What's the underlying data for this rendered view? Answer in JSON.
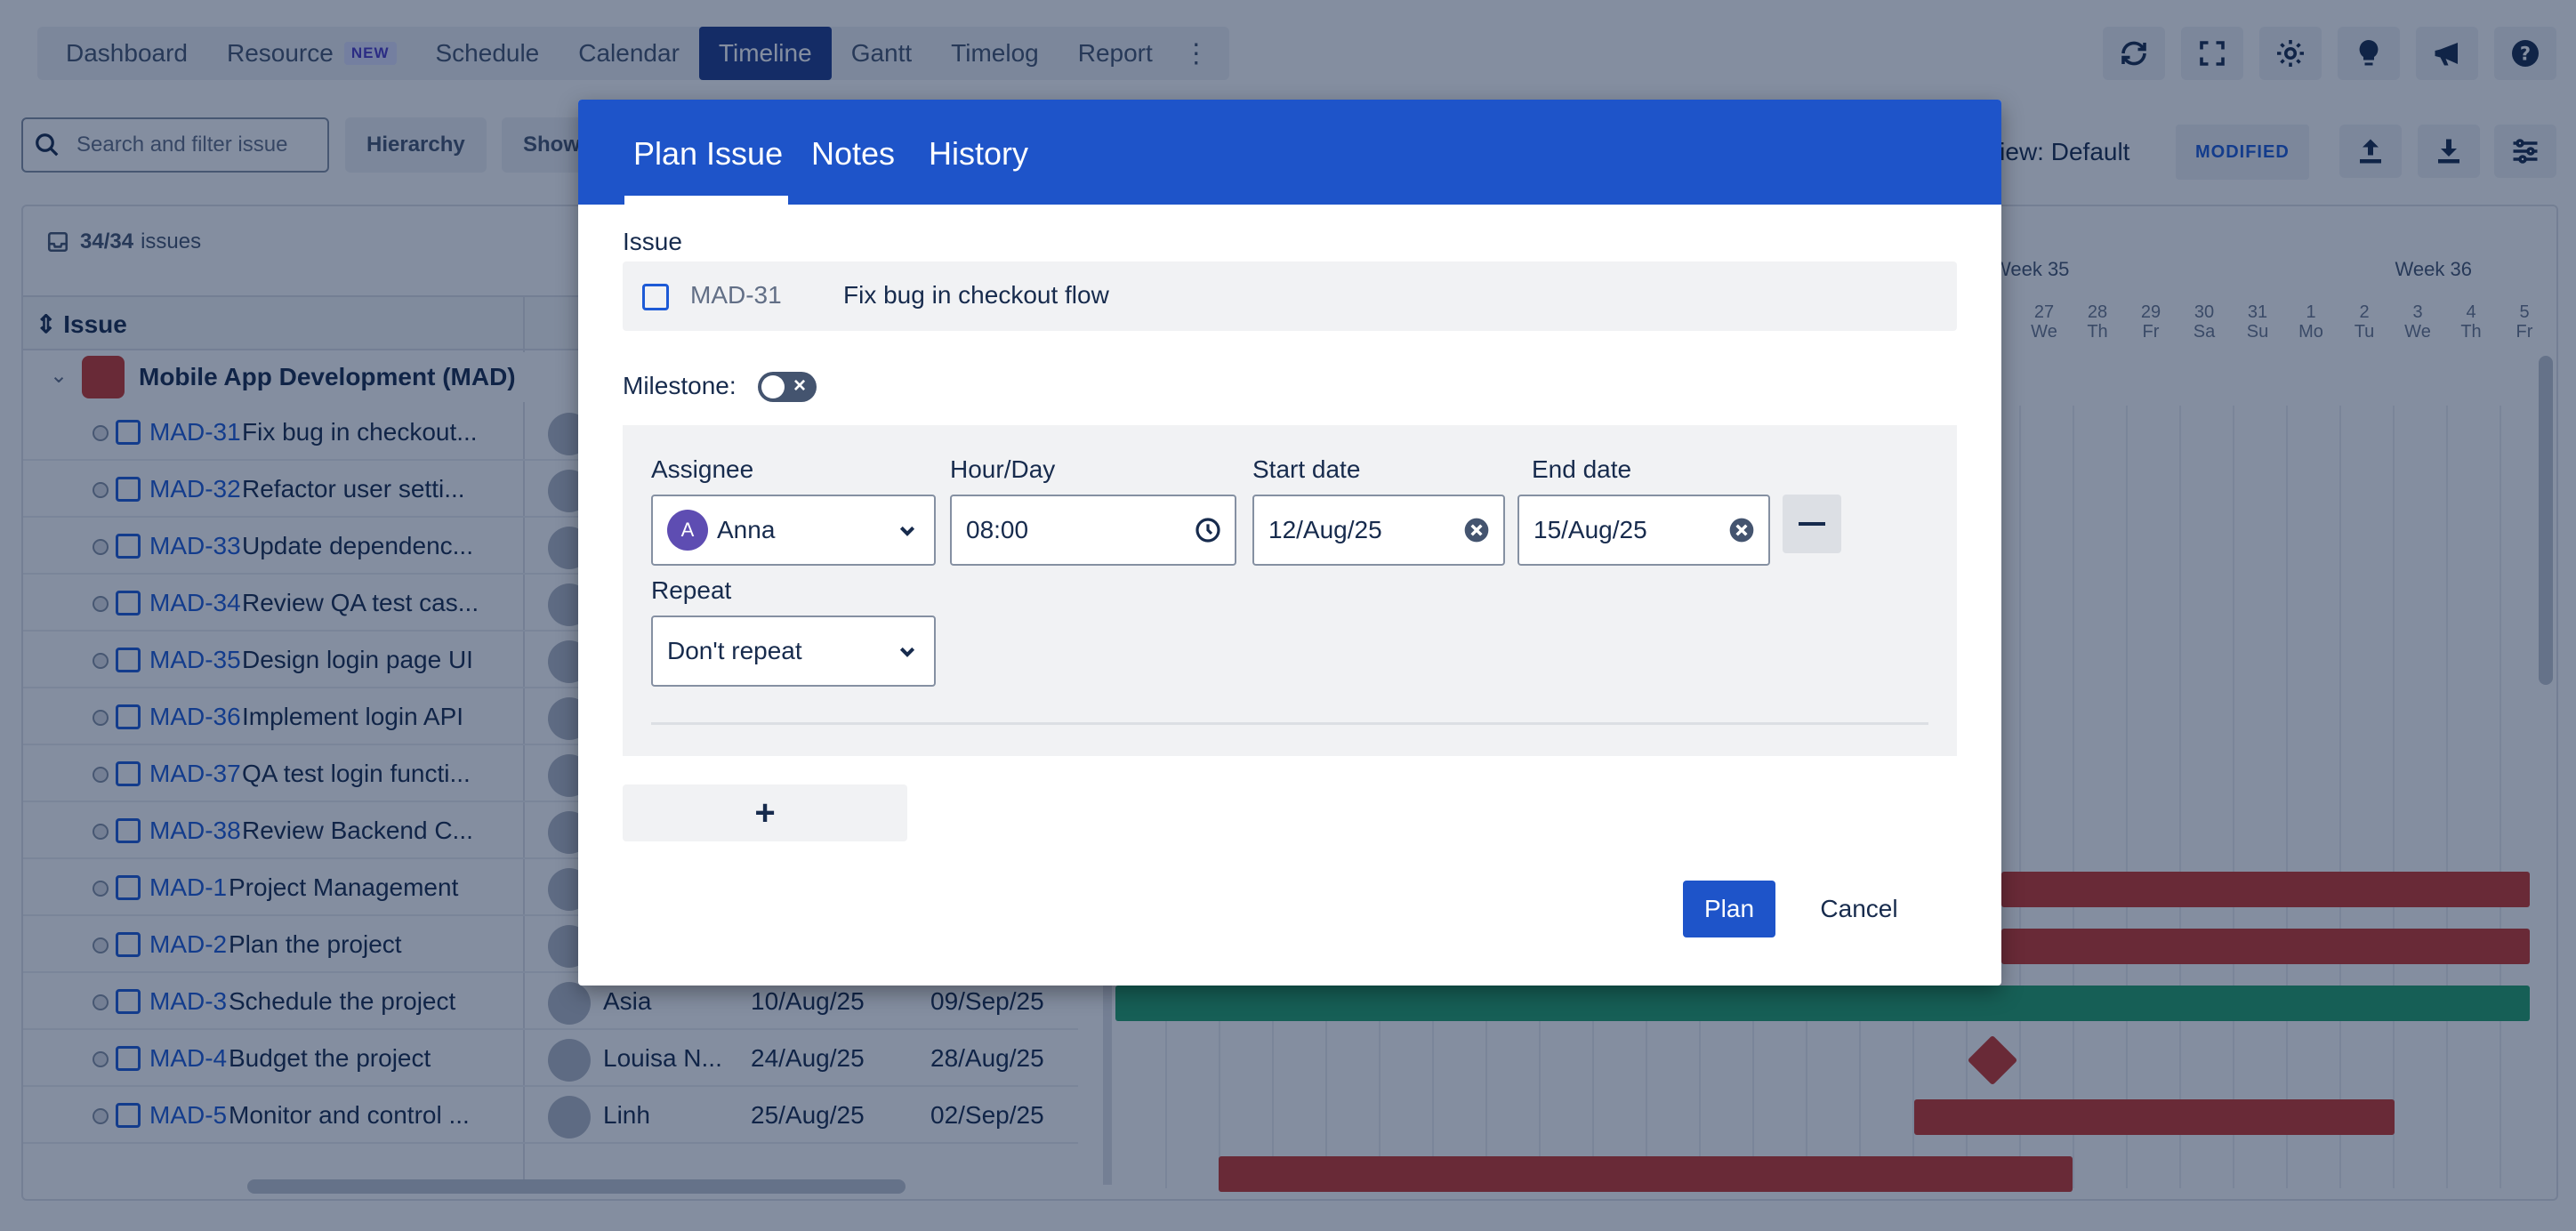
{
  "nav": {
    "tabs": [
      {
        "label": "Dashboard"
      },
      {
        "label": "Resource",
        "badge": "NEW"
      },
      {
        "label": "Schedule"
      },
      {
        "label": "Calendar"
      },
      {
        "label": "Timeline",
        "active": true
      },
      {
        "label": "Gantt"
      },
      {
        "label": "Timelog"
      },
      {
        "label": "Report"
      }
    ],
    "icons": [
      "refresh-icon",
      "fullscreen-icon",
      "settings-icon",
      "lightbulb-icon",
      "megaphone-icon",
      "help-icon"
    ]
  },
  "toolbar": {
    "search_placeholder": "Search and filter issue",
    "hierarchy_label": "Hierarchy",
    "show_label": "Show",
    "view_label": "View: Default",
    "modified_badge": "MODIFIED"
  },
  "grid": {
    "issues_count": "34/34",
    "issues_word": "issues",
    "issue_column": "Issue",
    "group": "Mobile App Development  (MAD)",
    "weeks": [
      "Week 35",
      "Week 36"
    ],
    "days": [
      {
        "d": "27",
        "w": "We"
      },
      {
        "d": "28",
        "w": "Th"
      },
      {
        "d": "29",
        "w": "Fr"
      },
      {
        "d": "30",
        "w": "Sa"
      },
      {
        "d": "31",
        "w": "Su"
      },
      {
        "d": "1",
        "w": "Mo"
      },
      {
        "d": "2",
        "w": "Tu"
      },
      {
        "d": "3",
        "w": "We"
      },
      {
        "d": "4",
        "w": "Th"
      },
      {
        "d": "5",
        "w": "Fr"
      }
    ],
    "rows": [
      {
        "key": "MAD-31",
        "title": "Fix bug in checkout...",
        "assignee": "",
        "start": "",
        "end": ""
      },
      {
        "key": "MAD-32",
        "title": "Refactor user setti...",
        "assignee": "",
        "start": "",
        "end": ""
      },
      {
        "key": "MAD-33",
        "title": "Update dependenc...",
        "assignee": "",
        "start": "",
        "end": ""
      },
      {
        "key": "MAD-34",
        "title": "Review QA test cas...",
        "assignee": "",
        "start": "",
        "end": ""
      },
      {
        "key": "MAD-35",
        "title": "Design login page UI",
        "assignee": "",
        "start": "",
        "end": ""
      },
      {
        "key": "MAD-36",
        "title": "Implement login API",
        "assignee": "",
        "start": "",
        "end": ""
      },
      {
        "key": "MAD-37",
        "title": "QA test login functi...",
        "assignee": "",
        "start": "",
        "end": ""
      },
      {
        "key": "MAD-38",
        "title": "Review Backend C...",
        "assignee": "",
        "start": "",
        "end": ""
      },
      {
        "key": "MAD-1",
        "title": "Project Management",
        "assignee": "",
        "start": "",
        "end": ""
      },
      {
        "key": "MAD-2",
        "title": "Plan the project",
        "assignee": "",
        "start": "",
        "end": ""
      },
      {
        "key": "MAD-3",
        "title": "Schedule the project",
        "assignee": "Asia",
        "start": "10/Aug/25",
        "end": "09/Sep/25"
      },
      {
        "key": "MAD-4",
        "title": "Budget the project",
        "assignee": "Louisa N...",
        "start": "24/Aug/25",
        "end": "28/Aug/25"
      },
      {
        "key": "MAD-5",
        "title": "Monitor and control ...",
        "assignee": "Linh",
        "start": "25/Aug/25",
        "end": "02/Sep/25"
      }
    ]
  },
  "modal": {
    "tabs": [
      "Plan Issue",
      "Notes",
      "History"
    ],
    "issue_label": "Issue",
    "issue_key": "MAD-31",
    "issue_title": "Fix bug in checkout flow",
    "milestone_label": "Milestone:",
    "assignee_label": "Assignee",
    "assignee_value": "Anna",
    "assignee_initial": "A",
    "hourday_label": "Hour/Day",
    "hourday_value": "08:00",
    "start_label": "Start date",
    "start_value": "12/Aug/25",
    "end_label": "End date",
    "end_value": "15/Aug/25",
    "repeat_label": "Repeat",
    "repeat_value": "Don't repeat",
    "add_label": "+",
    "plan_label": "Plan",
    "cancel_label": "Cancel"
  }
}
